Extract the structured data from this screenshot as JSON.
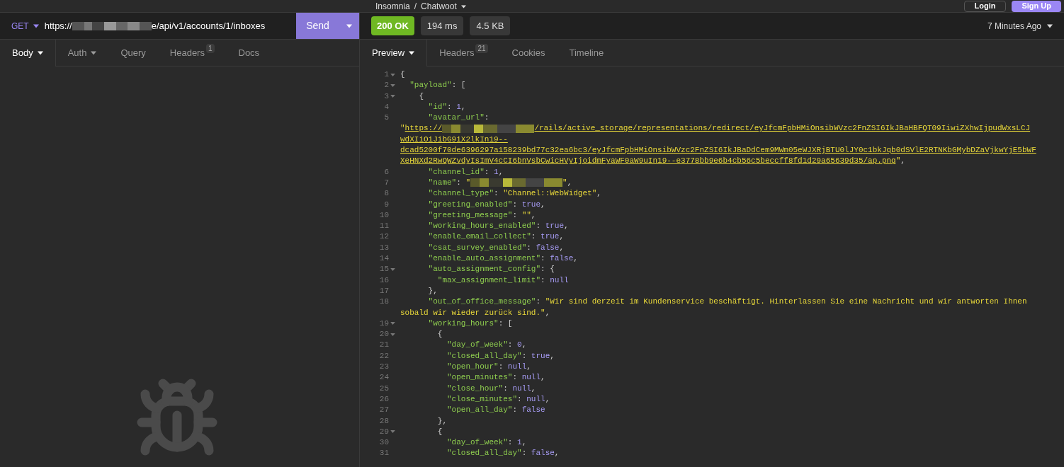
{
  "app_bar": {
    "title": "Insomnia",
    "separator": "/",
    "workspace": "Chatwoot",
    "buttons": [
      {
        "label": "Login",
        "kind": "outline"
      },
      {
        "label": "Sign Up",
        "kind": "filled"
      }
    ]
  },
  "request": {
    "method": "GET",
    "url_prefix": "https://",
    "url_suffix": "e/api/v1/accounts/1/inboxes",
    "send": "Send",
    "tabs": [
      {
        "label": "Body",
        "selected": true,
        "dropdown": true
      },
      {
        "label": "Auth",
        "selected": false,
        "dropdown": true
      },
      {
        "label": "Query",
        "selected": false,
        "dropdown": false
      },
      {
        "label": "Headers",
        "badge": "1",
        "selected": false,
        "dropdown": false
      },
      {
        "label": "Docs",
        "selected": false,
        "dropdown": false
      }
    ]
  },
  "response": {
    "status": "200 OK",
    "time": "194 ms",
    "size": "4.5 KB",
    "history": "7 Minutes Ago",
    "tabs": [
      {
        "label": "Preview",
        "selected": true,
        "dropdown": true
      },
      {
        "label": "Headers",
        "badge": "21",
        "selected": false,
        "dropdown": false
      },
      {
        "label": "Cookies",
        "selected": false,
        "dropdown": false
      },
      {
        "label": "Timeline",
        "selected": false,
        "dropdown": false
      }
    ],
    "lines": [
      {
        "no": "1",
        "fold": true,
        "tokens": [
          {
            "kind": "punct",
            "text": "{"
          }
        ]
      },
      {
        "no": "2",
        "fold": true,
        "tokens": [
          {
            "kind": "key",
            "text": "  \"payload\""
          },
          {
            "kind": "punct",
            "text": ": ["
          }
        ]
      },
      {
        "no": "3",
        "fold": true,
        "tokens": [
          {
            "kind": "punct",
            "text": "    {"
          }
        ]
      },
      {
        "no": "4",
        "fold": false,
        "tokens": [
          {
            "kind": "key",
            "text": "      \"id\""
          },
          {
            "kind": "punct",
            "text": ": "
          },
          {
            "kind": "value",
            "text": "1"
          },
          {
            "kind": "punct",
            "text": ","
          }
        ]
      },
      {
        "no": "5",
        "fold": false,
        "tokens": [
          {
            "kind": "key",
            "text": "      \"avatar_url\""
          },
          {
            "kind": "punct",
            "text": ":"
          }
        ],
        "wrapped": [
          [
            {
              "kind": "string",
              "text": "\""
            },
            {
              "kind": "link",
              "text": "https://"
            },
            {
              "kind": "redacted"
            },
            {
              "kind": "link",
              "text": "/rails/active_storage/representations/redirect/eyJfcmFpbHMiOnsibWVzc2FnZSI6IkJBaHBFQT09IiwiZXhwIjpudWxsLCJ"
            }
          ],
          [
            {
              "kind": "link",
              "text": "wdXIiOiJibG9iX2lkIn19--"
            }
          ],
          [
            {
              "kind": "link",
              "text": "dcad5200f70de6396297a158239bd77c32ea6bc3/eyJfcmFpbHMiOnsibWVzc2FnZSI6IkJBaDdCem9MWm05eWJXRjBTU0lJY0c1bkJqb0dSVlE2RTNKbGMybDZaVjkwYjE5bWF"
            }
          ],
          [
            {
              "kind": "link",
              "text": "XeHNXd2RwQWZvdyIsImV4cCI6bnVsbCwicHVyIjoidmFyaWF0aW9uIn19--e3778bb9e6b4cb56c5beccff8fd1d29a65639d35/ap.png"
            },
            {
              "kind": "string",
              "text": "\""
            },
            {
              "kind": "punct",
              "text": ","
            }
          ]
        ]
      },
      {
        "no": "6",
        "fold": false,
        "tokens": [
          {
            "kind": "key",
            "text": "      \"channel_id\""
          },
          {
            "kind": "punct",
            "text": ": "
          },
          {
            "kind": "value",
            "text": "1"
          },
          {
            "kind": "punct",
            "text": ","
          }
        ]
      },
      {
        "no": "7",
        "fold": false,
        "tokens": [
          {
            "kind": "key",
            "text": "      \"name\""
          },
          {
            "kind": "punct",
            "text": ": "
          },
          {
            "kind": "string",
            "text": "\""
          },
          {
            "kind": "redacted"
          },
          {
            "kind": "string",
            "text": "\""
          },
          {
            "kind": "punct",
            "text": ","
          }
        ]
      },
      {
        "no": "8",
        "fold": false,
        "tokens": [
          {
            "kind": "key",
            "text": "      \"channel_type\""
          },
          {
            "kind": "punct",
            "text": ": "
          },
          {
            "kind": "string",
            "text": "\"Channel::WebWidget\""
          },
          {
            "kind": "punct",
            "text": ","
          }
        ]
      },
      {
        "no": "9",
        "fold": false,
        "tokens": [
          {
            "kind": "key",
            "text": "      \"greeting_enabled\""
          },
          {
            "kind": "punct",
            "text": ": "
          },
          {
            "kind": "value",
            "text": "true"
          },
          {
            "kind": "punct",
            "text": ","
          }
        ]
      },
      {
        "no": "10",
        "fold": false,
        "tokens": [
          {
            "kind": "key",
            "text": "      \"greeting_message\""
          },
          {
            "kind": "punct",
            "text": ": "
          },
          {
            "kind": "string",
            "text": "\"\""
          },
          {
            "kind": "punct",
            "text": ","
          }
        ]
      },
      {
        "no": "11",
        "fold": false,
        "tokens": [
          {
            "kind": "key",
            "text": "      \"working_hours_enabled\""
          },
          {
            "kind": "punct",
            "text": ": "
          },
          {
            "kind": "value",
            "text": "true"
          },
          {
            "kind": "punct",
            "text": ","
          }
        ]
      },
      {
        "no": "12",
        "fold": false,
        "tokens": [
          {
            "kind": "key",
            "text": "      \"enable_email_collect\""
          },
          {
            "kind": "punct",
            "text": ": "
          },
          {
            "kind": "value",
            "text": "true"
          },
          {
            "kind": "punct",
            "text": ","
          }
        ]
      },
      {
        "no": "13",
        "fold": false,
        "tokens": [
          {
            "kind": "key",
            "text": "      \"csat_survey_enabled\""
          },
          {
            "kind": "punct",
            "text": ": "
          },
          {
            "kind": "value",
            "text": "false"
          },
          {
            "kind": "punct",
            "text": ","
          }
        ]
      },
      {
        "no": "14",
        "fold": false,
        "tokens": [
          {
            "kind": "key",
            "text": "      \"enable_auto_assignment\""
          },
          {
            "kind": "punct",
            "text": ": "
          },
          {
            "kind": "value",
            "text": "false"
          },
          {
            "kind": "punct",
            "text": ","
          }
        ]
      },
      {
        "no": "15",
        "fold": true,
        "tokens": [
          {
            "kind": "key",
            "text": "      \"auto_assignment_config\""
          },
          {
            "kind": "punct",
            "text": ": {"
          }
        ]
      },
      {
        "no": "16",
        "fold": false,
        "tokens": [
          {
            "kind": "key",
            "text": "        \"max_assignment_limit\""
          },
          {
            "kind": "punct",
            "text": ": "
          },
          {
            "kind": "value",
            "text": "null"
          }
        ]
      },
      {
        "no": "17",
        "fold": false,
        "tokens": [
          {
            "kind": "punct",
            "text": "      },"
          }
        ]
      },
      {
        "no": "18",
        "fold": false,
        "tokens": [
          {
            "kind": "key",
            "text": "      \"out_of_office_message\""
          },
          {
            "kind": "punct",
            "text": ": "
          },
          {
            "kind": "string",
            "text": "\"Wir sind derzeit im Kundenservice beschäftigt. Hinterlassen Sie eine Nachricht und wir antworten Ihnen"
          }
        ],
        "wrapped": [
          [
            {
              "kind": "string",
              "text": "sobald wir wieder zurück sind.\""
            },
            {
              "kind": "punct",
              "text": ","
            }
          ]
        ]
      },
      {
        "no": "19",
        "fold": true,
        "tokens": [
          {
            "kind": "key",
            "text": "      \"working_hours\""
          },
          {
            "kind": "punct",
            "text": ": ["
          }
        ]
      },
      {
        "no": "20",
        "fold": true,
        "tokens": [
          {
            "kind": "punct",
            "text": "        {"
          }
        ]
      },
      {
        "no": "21",
        "fold": false,
        "tokens": [
          {
            "kind": "key",
            "text": "          \"day_of_week\""
          },
          {
            "kind": "punct",
            "text": ": "
          },
          {
            "kind": "value",
            "text": "0"
          },
          {
            "kind": "punct",
            "text": ","
          }
        ]
      },
      {
        "no": "22",
        "fold": false,
        "tokens": [
          {
            "kind": "key",
            "text": "          \"closed_all_day\""
          },
          {
            "kind": "punct",
            "text": ": "
          },
          {
            "kind": "value",
            "text": "true"
          },
          {
            "kind": "punct",
            "text": ","
          }
        ]
      },
      {
        "no": "23",
        "fold": false,
        "tokens": [
          {
            "kind": "key",
            "text": "          \"open_hour\""
          },
          {
            "kind": "punct",
            "text": ": "
          },
          {
            "kind": "value",
            "text": "null"
          },
          {
            "kind": "punct",
            "text": ","
          }
        ]
      },
      {
        "no": "24",
        "fold": false,
        "tokens": [
          {
            "kind": "key",
            "text": "          \"open_minutes\""
          },
          {
            "kind": "punct",
            "text": ": "
          },
          {
            "kind": "value",
            "text": "null"
          },
          {
            "kind": "punct",
            "text": ","
          }
        ]
      },
      {
        "no": "25",
        "fold": false,
        "tokens": [
          {
            "kind": "key",
            "text": "          \"close_hour\""
          },
          {
            "kind": "punct",
            "text": ": "
          },
          {
            "kind": "value",
            "text": "null"
          },
          {
            "kind": "punct",
            "text": ","
          }
        ]
      },
      {
        "no": "26",
        "fold": false,
        "tokens": [
          {
            "kind": "key",
            "text": "          \"close_minutes\""
          },
          {
            "kind": "punct",
            "text": ": "
          },
          {
            "kind": "value",
            "text": "null"
          },
          {
            "kind": "punct",
            "text": ","
          }
        ]
      },
      {
        "no": "27",
        "fold": false,
        "tokens": [
          {
            "kind": "key",
            "text": "          \"open_all_day\""
          },
          {
            "kind": "punct",
            "text": ": "
          },
          {
            "kind": "value",
            "text": "false"
          }
        ]
      },
      {
        "no": "28",
        "fold": false,
        "tokens": [
          {
            "kind": "punct",
            "text": "        },"
          }
        ]
      },
      {
        "no": "29",
        "fold": true,
        "tokens": [
          {
            "kind": "punct",
            "text": "        {"
          }
        ]
      },
      {
        "no": "30",
        "fold": false,
        "tokens": [
          {
            "kind": "key",
            "text": "          \"day_of_week\""
          },
          {
            "kind": "punct",
            "text": ": "
          },
          {
            "kind": "value",
            "text": "1"
          },
          {
            "kind": "punct",
            "text": ","
          }
        ]
      },
      {
        "no": "31",
        "fold": false,
        "tokens": [
          {
            "kind": "key",
            "text": "          \"closed_all_day\""
          },
          {
            "kind": "punct",
            "text": ": "
          },
          {
            "kind": "value",
            "text": "false"
          },
          {
            "kind": "punct",
            "text": ","
          }
        ]
      }
    ]
  }
}
